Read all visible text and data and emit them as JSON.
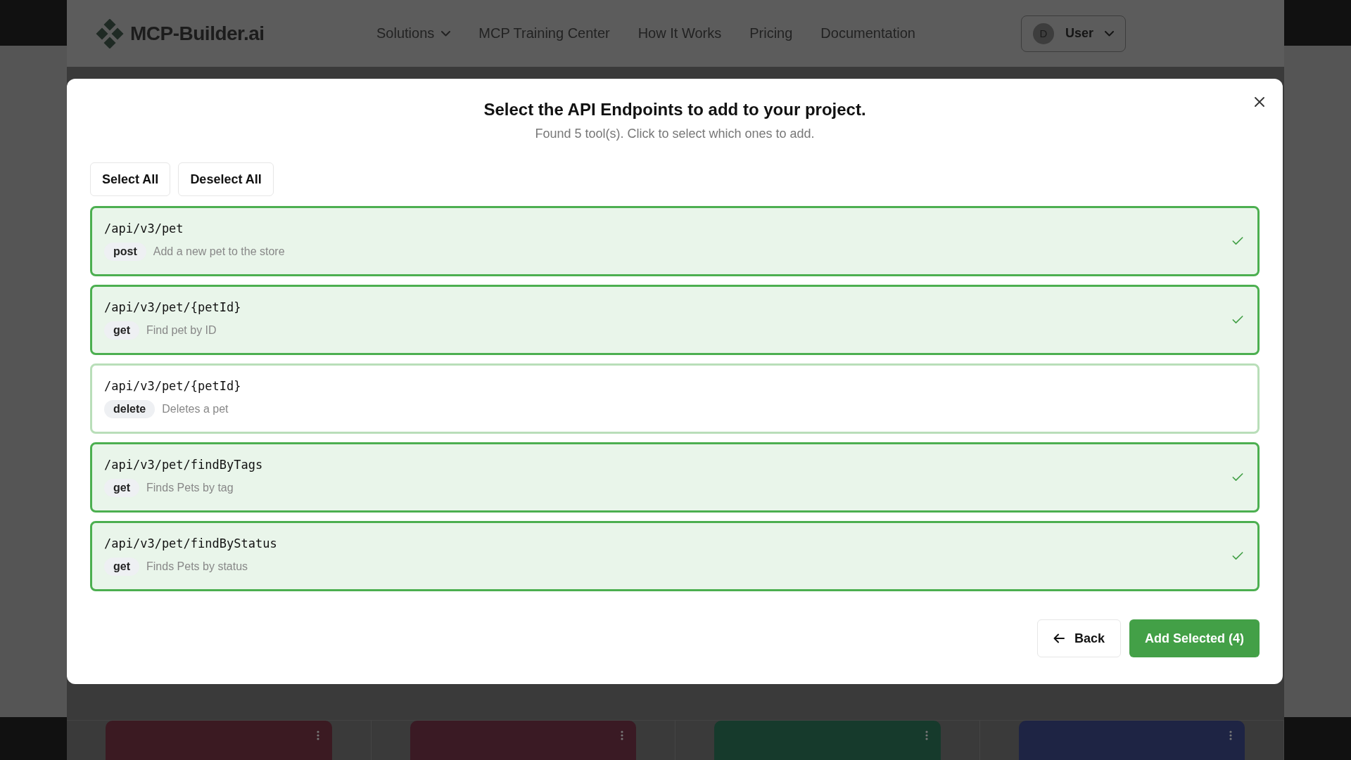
{
  "header": {
    "logo": "MCP-Builder.ai",
    "nav": [
      {
        "label": "Solutions",
        "dropdown": true
      },
      {
        "label": "MCP Training Center",
        "dropdown": false
      },
      {
        "label": "How It Works",
        "dropdown": false
      },
      {
        "label": "Pricing",
        "dropdown": false
      },
      {
        "label": "Documentation",
        "dropdown": false
      }
    ],
    "user": {
      "initial": "D",
      "name": "User"
    }
  },
  "modal": {
    "title": "Select the API Endpoints to add to your project.",
    "subtitle": "Found 5 tool(s). Click to select which ones to add.",
    "actions": [
      "Select All",
      "Deselect All"
    ],
    "endpoints": [
      {
        "path": "/api/v3/pet",
        "method": "post",
        "description": "Add a new pet to the store",
        "selected": true
      },
      {
        "path": "/api/v3/pet/{petId}",
        "method": "get",
        "description": "Find pet by ID",
        "selected": true
      },
      {
        "path": "/api/v3/pet/{petId}",
        "method": "delete",
        "description": "Deletes a pet",
        "selected": false
      },
      {
        "path": "/api/v3/pet/findByTags",
        "method": "get",
        "description": "Finds Pets by tag",
        "selected": true
      },
      {
        "path": "/api/v3/pet/findByStatus",
        "method": "get",
        "description": "Finds Pets by status",
        "selected": true
      }
    ],
    "back": "Back",
    "submit": "Add Selected (4)"
  },
  "background_cards": [
    {
      "color": "#3b1a22"
    },
    {
      "color": "#3a1a24"
    },
    {
      "color": "#163a2c"
    },
    {
      "color": "#1e2444"
    }
  ]
}
